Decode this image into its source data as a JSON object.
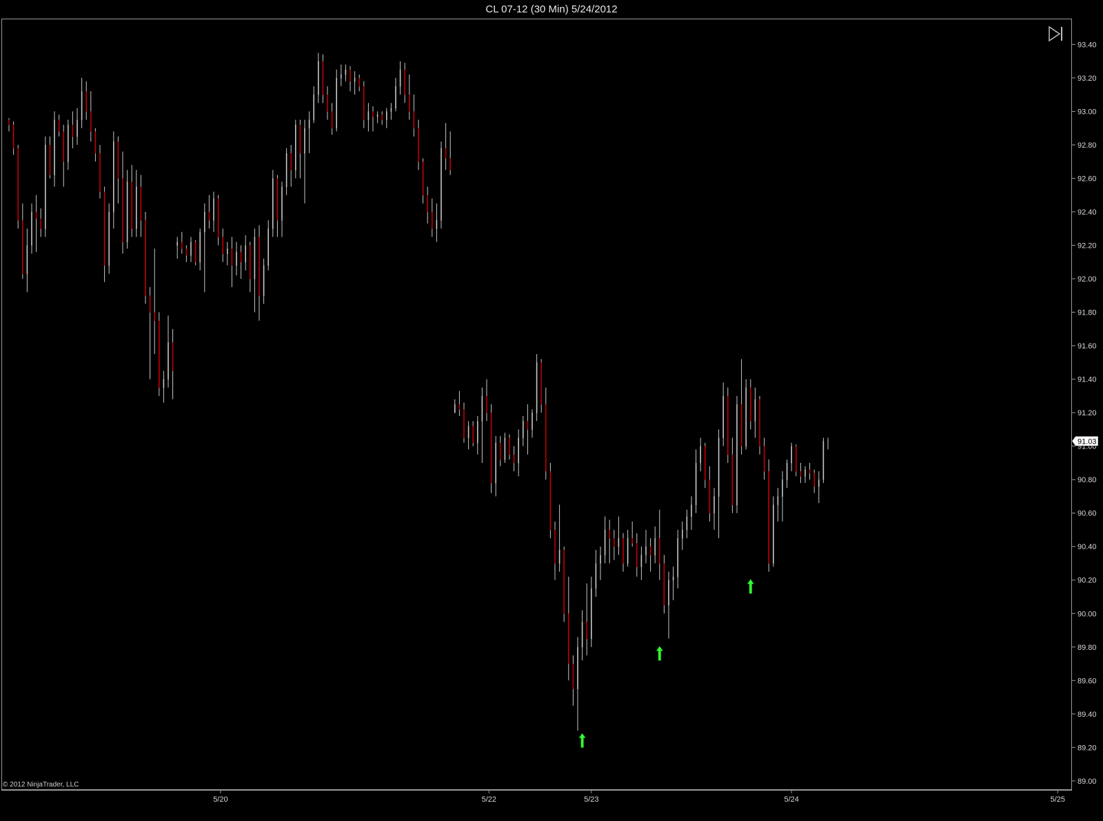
{
  "window": {
    "title": "CL 07-12 (30 Min)  5/24/2012",
    "copyright": "© 2012 NinjaTrader, LLC"
  },
  "colors": {
    "background": "#000000",
    "frame": "#9a9a9a",
    "up_bar": "#c8c8c8",
    "down_bar": "#c00000",
    "signal_arrow": "#33ff33",
    "price_marker_bg": "#ffffff",
    "price_marker_text": "#000000"
  },
  "icons": {
    "scroll_end": "skip-to-end-icon",
    "signal": "arrow-up-icon"
  },
  "chart_data": {
    "type": "ohlc",
    "instrument": "CL 07-12",
    "interval": "30 Min",
    "ylim": [
      88.95,
      93.55
    ],
    "y_ticks": [
      "93.40",
      "93.20",
      "93.00",
      "92.80",
      "92.60",
      "92.40",
      "92.20",
      "92.00",
      "91.80",
      "91.60",
      "91.40",
      "91.20",
      "91.00",
      "90.80",
      "90.60",
      "90.40",
      "90.20",
      "90.00",
      "89.80",
      "89.60",
      "89.40",
      "89.20",
      "89.00"
    ],
    "x_ticks": [
      {
        "label": "5/20",
        "index": 46.5
      },
      {
        "label": "5/22",
        "index": 105.5
      },
      {
        "label": "5/23",
        "index": 128
      },
      {
        "label": "5/24",
        "index": 172
      },
      {
        "label": "5/25",
        "index": 230.5
      }
    ],
    "current_price": "91.03",
    "bars_index_start": 0,
    "bars": [
      [
        92.95,
        92.96,
        92.88,
        92.92
      ],
      [
        92.92,
        92.94,
        92.74,
        92.78
      ],
      [
        92.78,
        92.8,
        92.3,
        92.35
      ],
      [
        92.35,
        92.45,
        92.0,
        92.03
      ],
      [
        92.03,
        92.3,
        91.92,
        92.2
      ],
      [
        92.2,
        92.45,
        92.15,
        92.4
      ],
      [
        92.4,
        92.5,
        92.16,
        92.36
      ],
      [
        92.36,
        92.42,
        92.25,
        92.3
      ],
      [
        92.3,
        92.85,
        92.25,
        92.8
      ],
      [
        92.8,
        92.85,
        92.6,
        92.62
      ],
      [
        92.62,
        93.0,
        92.55,
        92.95
      ],
      [
        92.95,
        92.98,
        92.85,
        92.88
      ],
      [
        92.88,
        92.92,
        92.55,
        92.7
      ],
      [
        92.7,
        92.95,
        92.65,
        92.92
      ],
      [
        92.92,
        93.0,
        92.78,
        92.85
      ],
      [
        92.85,
        93.02,
        92.8,
        92.95
      ],
      [
        92.95,
        93.2,
        92.9,
        93.12
      ],
      [
        93.12,
        93.18,
        92.95,
        93.0
      ],
      [
        93.0,
        93.12,
        92.82,
        92.88
      ],
      [
        92.88,
        92.9,
        92.7,
        92.75
      ],
      [
        92.75,
        92.8,
        92.48,
        92.52
      ],
      [
        92.52,
        92.55,
        91.98,
        92.08
      ],
      [
        92.08,
        92.45,
        92.03,
        92.4
      ],
      [
        92.4,
        92.88,
        92.3,
        92.82
      ],
      [
        92.82,
        92.85,
        92.45,
        92.6
      ],
      [
        92.6,
        92.76,
        92.15,
        92.22
      ],
      [
        92.22,
        92.65,
        92.18,
        92.58
      ],
      [
        92.58,
        92.68,
        92.25,
        92.3
      ],
      [
        92.3,
        92.65,
        92.25,
        92.55
      ],
      [
        92.55,
        92.62,
        92.25,
        92.35
      ],
      [
        92.35,
        92.4,
        91.85,
        91.9
      ],
      [
        91.9,
        91.95,
        91.4,
        91.8
      ],
      [
        91.8,
        92.18,
        91.55,
        91.75
      ],
      [
        91.75,
        91.8,
        91.3,
        91.35
      ],
      [
        91.35,
        91.45,
        91.26,
        91.4
      ],
      [
        91.4,
        91.78,
        91.35,
        91.62
      ],
      [
        91.62,
        91.7,
        91.28,
        91.45
      ],
      [
        92.2,
        92.25,
        92.12,
        92.22
      ],
      [
        92.22,
        92.28,
        92.15,
        92.18
      ],
      [
        92.18,
        92.2,
        92.1,
        92.14
      ],
      [
        92.14,
        92.25,
        92.1,
        92.22
      ],
      [
        92.22,
        92.23,
        92.08,
        92.1
      ],
      [
        92.1,
        92.3,
        92.05,
        92.28
      ],
      [
        92.28,
        92.45,
        91.92,
        92.4
      ],
      [
        92.4,
        92.5,
        92.3,
        92.35
      ],
      [
        92.35,
        92.52,
        92.28,
        92.48
      ],
      [
        92.48,
        92.5,
        92.2,
        92.25
      ],
      [
        92.25,
        92.3,
        92.1,
        92.15
      ],
      [
        92.15,
        92.22,
        92.08,
        92.18
      ],
      [
        92.18,
        92.25,
        91.95,
        92.08
      ],
      [
        92.08,
        92.22,
        92.02,
        92.16
      ],
      [
        92.16,
        92.2,
        92.0,
        92.1
      ],
      [
        92.1,
        92.26,
        92.05,
        92.2
      ],
      [
        92.2,
        92.22,
        91.92,
        92.0
      ],
      [
        92.0,
        92.3,
        91.8,
        92.25
      ],
      [
        92.25,
        92.32,
        91.75,
        91.9
      ],
      [
        91.9,
        92.12,
        91.85,
        92.08
      ],
      [
        92.08,
        92.35,
        92.05,
        92.3
      ],
      [
        92.3,
        92.65,
        92.25,
        92.6
      ],
      [
        92.6,
        92.62,
        92.25,
        92.35
      ],
      [
        92.35,
        92.58,
        92.25,
        92.55
      ],
      [
        92.55,
        92.78,
        92.5,
        92.75
      ],
      [
        92.75,
        92.8,
        92.55,
        92.65
      ],
      [
        92.65,
        92.95,
        92.6,
        92.92
      ],
      [
        92.92,
        92.95,
        92.6,
        92.75
      ],
      [
        92.75,
        92.95,
        92.45,
        92.9
      ],
      [
        92.9,
        93.0,
        92.75,
        92.95
      ],
      [
        92.95,
        93.15,
        92.93,
        93.1
      ],
      [
        93.1,
        93.35,
        93.05,
        93.3
      ],
      [
        93.3,
        93.34,
        93.05,
        93.1
      ],
      [
        93.1,
        93.15,
        92.95,
        93.0
      ],
      [
        93.0,
        93.05,
        92.86,
        92.9
      ],
      [
        92.9,
        93.25,
        92.88,
        93.2
      ],
      [
        93.2,
        93.28,
        93.15,
        93.22
      ],
      [
        93.22,
        93.28,
        93.18,
        93.25
      ],
      [
        93.25,
        93.27,
        93.12,
        93.18
      ],
      [
        93.18,
        93.24,
        93.1,
        93.2
      ],
      [
        93.2,
        93.22,
        93.12,
        93.15
      ],
      [
        93.15,
        93.18,
        92.9,
        92.95
      ],
      [
        92.95,
        93.05,
        92.88,
        93.0
      ],
      [
        93.0,
        93.03,
        92.88,
        92.97
      ],
      [
        92.97,
        93.0,
        92.93,
        92.98
      ],
      [
        92.98,
        93.0,
        92.92,
        92.95
      ],
      [
        92.95,
        93.02,
        92.9,
        93.0
      ],
      [
        93.0,
        93.05,
        92.95,
        93.02
      ],
      [
        93.02,
        93.2,
        93.0,
        93.15
      ],
      [
        93.15,
        93.3,
        93.1,
        93.25
      ],
      [
        93.25,
        93.29,
        93.05,
        93.1
      ],
      [
        93.1,
        93.22,
        92.95,
        93.0
      ],
      [
        93.0,
        93.1,
        92.85,
        92.9
      ],
      [
        92.9,
        92.95,
        92.65,
        92.7
      ],
      [
        92.7,
        92.72,
        92.45,
        92.5
      ],
      [
        92.5,
        92.55,
        92.33,
        92.4
      ],
      [
        92.4,
        92.48,
        92.25,
        92.3
      ],
      [
        92.3,
        92.45,
        92.22,
        92.35
      ],
      [
        92.35,
        92.82,
        92.3,
        92.78
      ],
      [
        92.78,
        92.93,
        92.65,
        92.72
      ],
      [
        92.72,
        92.88,
        92.62,
        92.65
      ],
      [
        91.2,
        91.28,
        91.22,
        91.25
      ],
      [
        91.25,
        91.33,
        91.18,
        91.22
      ],
      [
        91.22,
        91.26,
        91.02,
        91.05
      ],
      [
        91.05,
        91.15,
        90.98,
        91.12
      ],
      [
        91.12,
        91.15,
        91.0,
        91.02
      ],
      [
        91.02,
        91.18,
        90.95,
        91.15
      ],
      [
        91.15,
        91.35,
        90.9,
        91.3
      ],
      [
        91.3,
        91.4,
        91.15,
        91.2
      ],
      [
        91.2,
        91.25,
        90.72,
        90.78
      ],
      [
        90.78,
        91.06,
        90.7,
        91.02
      ],
      [
        91.02,
        91.06,
        90.88,
        90.92
      ],
      [
        90.92,
        91.08,
        90.9,
        91.05
      ],
      [
        91.05,
        91.07,
        90.92,
        90.95
      ],
      [
        90.95,
        91.0,
        90.85,
        90.9
      ],
      [
        90.9,
        91.1,
        90.82,
        91.05
      ],
      [
        91.05,
        91.18,
        91.0,
        91.15
      ],
      [
        91.15,
        91.25,
        90.95,
        91.1
      ],
      [
        91.1,
        91.22,
        91.05,
        91.2
      ],
      [
        91.2,
        91.55,
        91.15,
        91.5
      ],
      [
        91.5,
        91.52,
        91.2,
        91.25
      ],
      [
        91.25,
        91.35,
        90.8,
        90.85
      ],
      [
        90.85,
        90.9,
        90.45,
        90.5
      ],
      [
        90.5,
        90.55,
        90.2,
        90.3
      ],
      [
        90.3,
        90.65,
        90.25,
        90.38
      ],
      [
        90.38,
        90.4,
        89.95,
        90.0
      ],
      [
        90.0,
        90.22,
        89.6,
        89.7
      ],
      [
        89.7,
        89.75,
        89.45,
        89.55
      ],
      [
        89.55,
        89.86,
        89.3,
        89.8
      ],
      [
        89.8,
        90.02,
        89.72,
        89.95
      ],
      [
        89.95,
        90.18,
        89.75,
        89.85
      ],
      [
        89.85,
        90.22,
        89.8,
        90.15
      ],
      [
        90.15,
        90.38,
        90.1,
        90.3
      ],
      [
        90.3,
        90.4,
        90.2,
        90.35
      ],
      [
        90.35,
        90.58,
        90.3,
        90.5
      ],
      [
        90.5,
        90.56,
        90.3,
        90.45
      ],
      [
        90.45,
        90.5,
        90.32,
        90.4
      ],
      [
        90.4,
        90.58,
        90.35,
        90.45
      ],
      [
        90.45,
        90.48,
        90.25,
        90.3
      ],
      [
        90.3,
        90.5,
        90.28,
        90.45
      ],
      [
        90.45,
        90.55,
        90.4,
        90.42
      ],
      [
        90.42,
        90.48,
        90.22,
        90.28
      ],
      [
        90.28,
        90.4,
        90.2,
        90.35
      ],
      [
        90.35,
        90.5,
        90.3,
        90.4
      ],
      [
        90.4,
        90.45,
        90.25,
        90.35
      ],
      [
        90.35,
        90.52,
        90.3,
        90.45
      ],
      [
        90.45,
        90.62,
        90.2,
        90.3
      ],
      [
        90.3,
        90.35,
        90.0,
        90.05
      ],
      [
        90.05,
        90.25,
        89.85,
        90.2
      ],
      [
        90.2,
        90.28,
        90.08,
        90.22
      ],
      [
        90.22,
        90.5,
        90.15,
        90.45
      ],
      [
        90.45,
        90.55,
        90.38,
        90.5
      ],
      [
        90.5,
        90.62,
        90.45,
        90.58
      ],
      [
        90.58,
        90.7,
        90.5,
        90.65
      ],
      [
        90.65,
        90.98,
        90.6,
        90.9
      ],
      [
        90.9,
        91.05,
        90.85,
        91.0
      ],
      [
        91.0,
        91.02,
        90.75,
        90.8
      ],
      [
        90.8,
        90.88,
        90.55,
        90.6
      ],
      [
        90.6,
        90.75,
        90.5,
        90.7
      ],
      [
        90.7,
        91.1,
        90.45,
        91.05
      ],
      [
        91.05,
        91.38,
        91.0,
        91.3
      ],
      [
        91.3,
        91.35,
        90.9,
        90.95
      ],
      [
        90.95,
        91.05,
        90.6,
        90.65
      ],
      [
        90.65,
        91.3,
        90.6,
        91.25
      ],
      [
        91.25,
        91.52,
        90.95,
        91.0
      ],
      [
        91.0,
        91.4,
        90.98,
        91.35
      ],
      [
        91.35,
        91.4,
        91.1,
        91.15
      ],
      [
        91.15,
        91.35,
        91.05,
        91.28
      ],
      [
        91.28,
        91.3,
        90.95,
        91.0
      ],
      [
        91.0,
        91.05,
        90.8,
        90.85
      ],
      [
        90.85,
        90.92,
        90.25,
        90.3
      ],
      [
        90.3,
        90.7,
        90.28,
        90.65
      ],
      [
        90.65,
        90.75,
        90.55,
        90.7
      ],
      [
        90.7,
        90.85,
        90.55,
        90.8
      ],
      [
        90.8,
        90.92,
        90.75,
        90.9
      ],
      [
        90.9,
        91.02,
        90.85,
        91.0
      ],
      [
        91.0,
        91.01,
        90.82,
        90.85
      ],
      [
        90.85,
        90.9,
        90.78,
        90.82
      ],
      [
        90.82,
        90.88,
        90.78,
        90.86
      ],
      [
        90.86,
        90.9,
        90.8,
        90.84
      ],
      [
        90.84,
        90.86,
        90.72,
        90.76
      ],
      [
        90.76,
        90.85,
        90.66,
        90.8
      ],
      [
        90.8,
        91.05,
        90.78,
        91.03
      ],
      [
        91.03,
        91.05,
        90.98,
        91.03
      ]
    ],
    "signals": [
      {
        "index": 126,
        "price": 89.24
      },
      {
        "index": 143,
        "price": 89.76
      },
      {
        "index": 163,
        "price": 90.16
      }
    ]
  }
}
